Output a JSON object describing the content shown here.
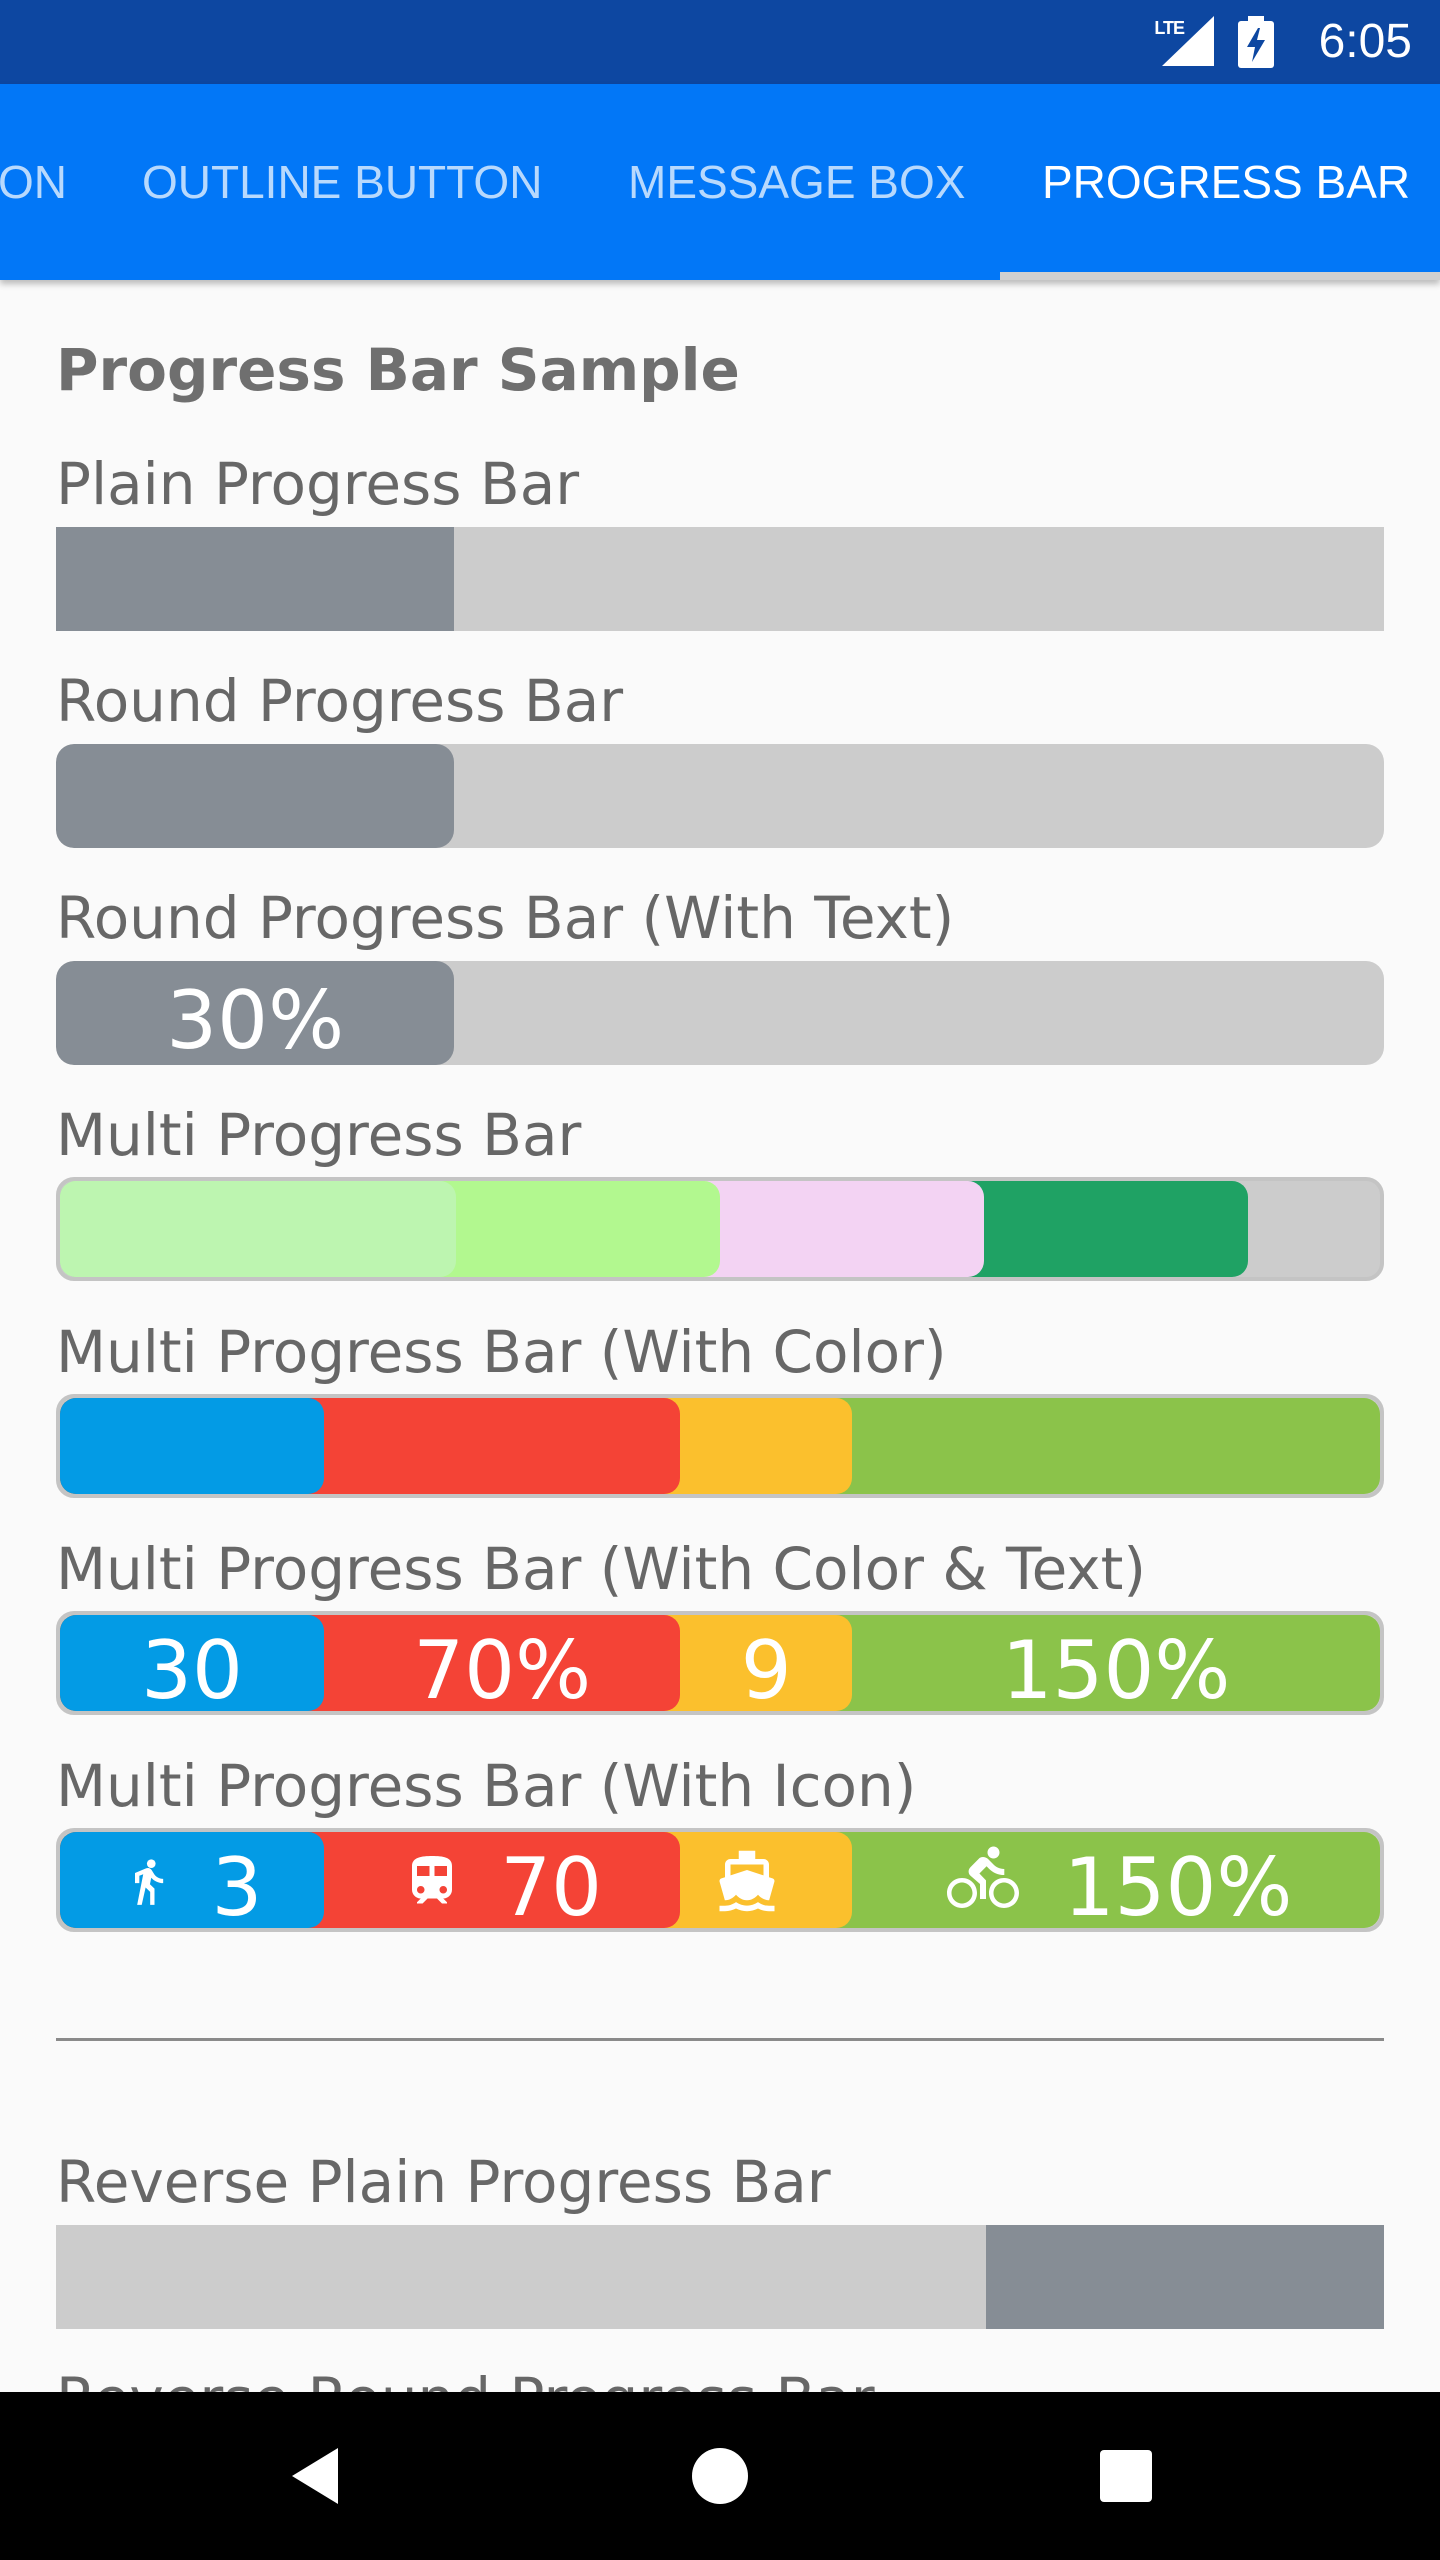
{
  "status_bar": {
    "time": "6:05",
    "network": "LTE",
    "icons": [
      "lte-signal-icon",
      "battery-charging-icon"
    ]
  },
  "tabs": [
    {
      "label": "ON",
      "active": false
    },
    {
      "label": "OUTLINE BUTTON",
      "active": false
    },
    {
      "label": "MESSAGE BOX",
      "active": false
    },
    {
      "label": "PROGRESS BAR",
      "active": true
    }
  ],
  "page": {
    "heading": "Progress Bar Sample",
    "plain": {
      "label": "Plain Progress Bar",
      "progress": 0.3
    },
    "round": {
      "label": "Round Progress Bar",
      "progress": 0.3
    },
    "round_text": {
      "label": "Round Progress Bar (With Text)",
      "progress": 0.3,
      "text": "30%"
    },
    "multi": {
      "label": "Multi Progress Bar",
      "segments": [
        {
          "end": 0.3,
          "color": "#bdf5b0"
        },
        {
          "end": 0.5,
          "color": "#b2f88f"
        },
        {
          "end": 0.7,
          "color": "#f3d3f3"
        },
        {
          "end": 0.9,
          "color": "#1fa264"
        }
      ]
    },
    "multi_color": {
      "label": "Multi Progress Bar (With Color)",
      "segments": [
        {
          "end": 0.2,
          "color": "#039be5"
        },
        {
          "end": 0.47,
          "color": "#f44336"
        },
        {
          "end": 0.6,
          "color": "#fbc02d"
        },
        {
          "end": 1.0,
          "color": "#8bc34a"
        }
      ]
    },
    "multi_color_text": {
      "label": "Multi Progress Bar (With Color & Text)",
      "segments": [
        {
          "end": 0.2,
          "color": "#039be5",
          "text": "30"
        },
        {
          "end": 0.47,
          "color": "#f44336",
          "text": "70%"
        },
        {
          "end": 0.6,
          "color": "#fbc02d",
          "text": "9"
        },
        {
          "end": 1.0,
          "color": "#8bc34a",
          "text": "150%"
        }
      ]
    },
    "multi_icon": {
      "label": "Multi Progress Bar (With Icon)",
      "segments": [
        {
          "end": 0.2,
          "color": "#039be5",
          "icon": "walk-icon",
          "text": "3"
        },
        {
          "end": 0.47,
          "color": "#f44336",
          "icon": "train-icon",
          "text": "70"
        },
        {
          "end": 0.6,
          "color": "#fbc02d",
          "icon": "ferry-icon",
          "text": ""
        },
        {
          "end": 1.0,
          "color": "#8bc34a",
          "icon": "bike-icon",
          "text": "150%"
        }
      ]
    },
    "reverse_plain": {
      "label": "Reverse Plain Progress Bar",
      "progress": 0.3
    },
    "reverse_round_label": "Reverse Round Progress Bar"
  },
  "nav_bar": {
    "buttons": [
      "back-icon",
      "home-icon",
      "recents-icon"
    ]
  }
}
